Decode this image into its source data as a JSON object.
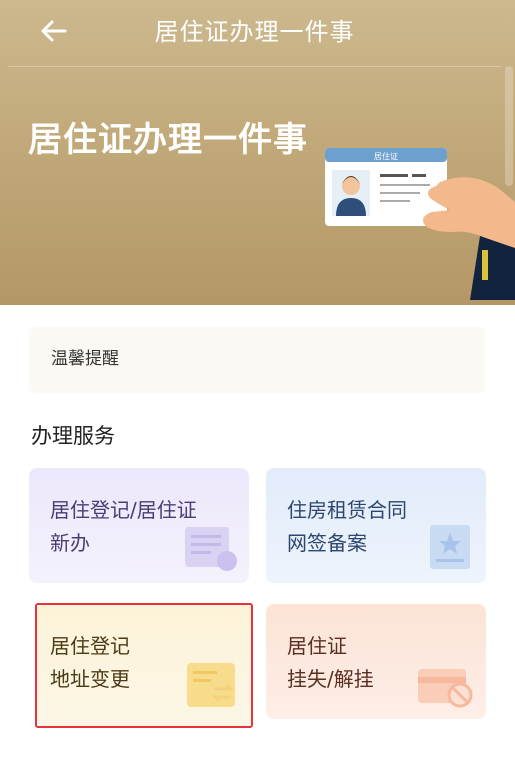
{
  "nav": {
    "title": "居住证办理一件事"
  },
  "banner": {
    "title": "居住证办理一件事",
    "card_label": "居住证"
  },
  "tip": {
    "label": "温馨提醒"
  },
  "services": {
    "section_title": "办理服务",
    "items": [
      {
        "label": "居住登记/居住证\n新办",
        "icon": "document-icon"
      },
      {
        "label": "住房租赁合同\n网签备案",
        "icon": "contract-star-icon"
      },
      {
        "label": "居住登记\n地址变更",
        "icon": "address-change-icon"
      },
      {
        "label": "居住证\n挂失/解挂",
        "icon": "card-block-icon"
      }
    ]
  },
  "colors": {
    "header": "#c3ab7c",
    "highlight_border": "#e8333a"
  }
}
